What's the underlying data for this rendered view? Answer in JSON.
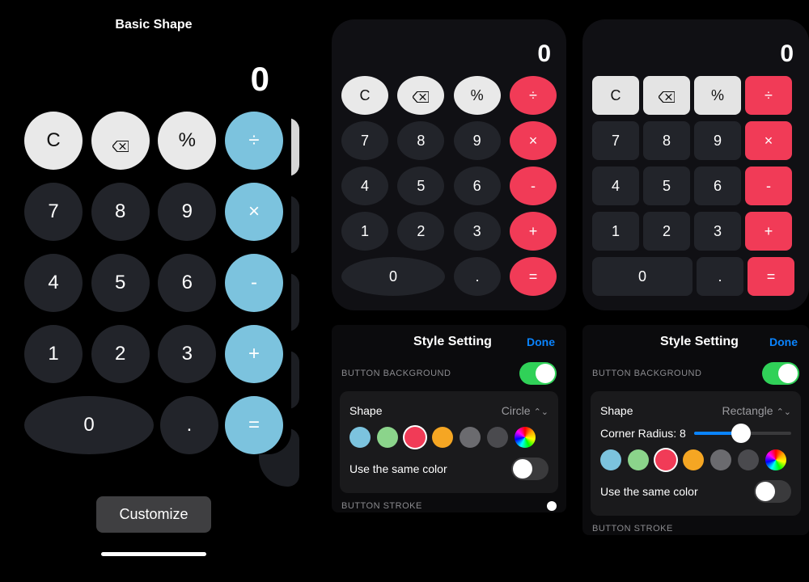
{
  "col1": {
    "title": "Basic Shape",
    "display": "0",
    "customize": "Customize",
    "rows": [
      [
        {
          "t": "C",
          "cls": "fn"
        },
        {
          "icon": "backspace",
          "cls": "fn"
        },
        {
          "t": "%",
          "cls": "fn"
        },
        {
          "t": "÷",
          "cls": "op"
        }
      ],
      [
        {
          "t": "7"
        },
        {
          "t": "8"
        },
        {
          "t": "9"
        },
        {
          "t": "×",
          "cls": "op"
        }
      ],
      [
        {
          "t": "4"
        },
        {
          "t": "5"
        },
        {
          "t": "6"
        },
        {
          "t": "-",
          "cls": "op"
        }
      ],
      [
        {
          "t": "1"
        },
        {
          "t": "2"
        },
        {
          "t": "3"
        },
        {
          "t": "+",
          "cls": "op"
        }
      ],
      [
        {
          "t": "0",
          "wide": true
        },
        {
          "t": "."
        },
        {
          "t": "=",
          "cls": "op"
        }
      ]
    ]
  },
  "calc2": {
    "display": "0",
    "rows": [
      [
        {
          "t": "C",
          "cls": "fn"
        },
        {
          "icon": "backspace",
          "cls": "fn"
        },
        {
          "t": "%",
          "cls": "fn"
        },
        {
          "t": "÷",
          "cls": "op"
        }
      ],
      [
        {
          "t": "7"
        },
        {
          "t": "8"
        },
        {
          "t": "9"
        },
        {
          "t": "×",
          "cls": "op"
        }
      ],
      [
        {
          "t": "4"
        },
        {
          "t": "5"
        },
        {
          "t": "6"
        },
        {
          "t": "-",
          "cls": "op"
        }
      ],
      [
        {
          "t": "1"
        },
        {
          "t": "2"
        },
        {
          "t": "3"
        },
        {
          "t": "+",
          "cls": "op"
        }
      ],
      [
        {
          "t": "0",
          "wide": true
        },
        {
          "t": "."
        },
        {
          "t": "=",
          "cls": "op"
        }
      ]
    ]
  },
  "calc3": {
    "display": "0",
    "rows": [
      [
        {
          "t": "C",
          "cls": "fn"
        },
        {
          "icon": "backspace",
          "cls": "fn"
        },
        {
          "t": "%",
          "cls": "fn"
        },
        {
          "t": "÷",
          "cls": "op"
        }
      ],
      [
        {
          "t": "7"
        },
        {
          "t": "8"
        },
        {
          "t": "9"
        },
        {
          "t": "×",
          "cls": "op"
        }
      ],
      [
        {
          "t": "4"
        },
        {
          "t": "5"
        },
        {
          "t": "6"
        },
        {
          "t": "-",
          "cls": "op"
        }
      ],
      [
        {
          "t": "1"
        },
        {
          "t": "2"
        },
        {
          "t": "3"
        },
        {
          "t": "+",
          "cls": "op"
        }
      ],
      [
        {
          "t": "0",
          "wide": true
        },
        {
          "t": "."
        },
        {
          "t": "=",
          "cls": "op"
        }
      ]
    ]
  },
  "panel2": {
    "title": "Style Setting",
    "done": "Done",
    "bgLabel": "BUTTON BACKGROUND",
    "shape": "Shape",
    "shapeValue": "Circle",
    "useSame": "Use the same color",
    "stroke": "BUTTON STROKE",
    "swatches": [
      "#7cc3de",
      "#8bd48b",
      "#f13b57",
      "#f5a623",
      "#6b6b6f",
      "#4a4a4e",
      "rainbow"
    ],
    "selected": 2,
    "bgToggle": true,
    "sameToggle": false
  },
  "panel3": {
    "title": "Style Setting",
    "done": "Done",
    "bgLabel": "BUTTON BACKGROUND",
    "shape": "Shape",
    "shapeValue": "Rectangle",
    "radiusLabel": "Corner Radius: 8",
    "radiusPct": 48,
    "useSame": "Use the same color",
    "stroke": "BUTTON STROKE",
    "swatches": [
      "#7cc3de",
      "#8bd48b",
      "#f13b57",
      "#f5a623",
      "#6b6b6f",
      "#4a4a4e",
      "rainbow"
    ],
    "selected": 2,
    "bgToggle": true,
    "sameToggle": false
  }
}
